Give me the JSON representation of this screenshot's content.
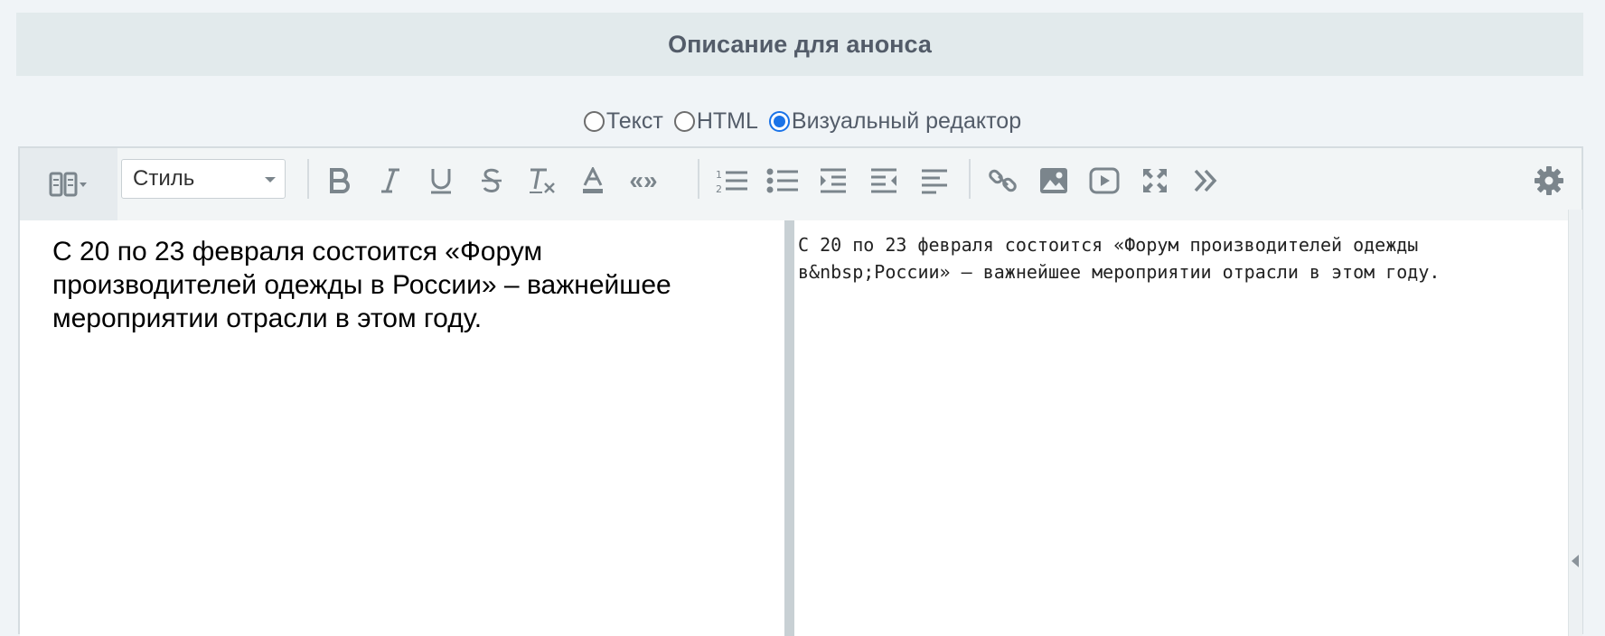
{
  "section": {
    "title": "Описание для анонса"
  },
  "modes": [
    {
      "label": "Текст",
      "checked": false
    },
    {
      "label": "HTML",
      "checked": false
    },
    {
      "label": "Визуальный редактор",
      "checked": true
    }
  ],
  "toolbar": {
    "style_select": "Стиль",
    "quote_label": "«»",
    "icons": [
      "view-mode-icon",
      "bold-icon",
      "italic-icon",
      "underline-icon",
      "strikethrough-icon",
      "clear-format-icon",
      "text-color-icon",
      "quote-icon",
      "ordered-list-icon",
      "bullet-list-icon",
      "indent-icon",
      "outdent-icon",
      "align-left-icon",
      "link-icon",
      "image-icon",
      "video-icon",
      "fullscreen-icon",
      "more-icon",
      "settings-icon"
    ]
  },
  "editor": {
    "visual_text": "С 20 по 23 февраля состоится «Форум производителей одежды в России» – важнейшее мероприятии отрасли в этом году.",
    "source_text": "С 20 по 23 февраля состоится «Форум производителей одежды в&nbsp;России» – важнейшее мероприятии отрасли в этом году."
  },
  "colors": {
    "accent": "#1a73e8",
    "header_bg": "#e2eaec",
    "icon": "#7b858c"
  }
}
